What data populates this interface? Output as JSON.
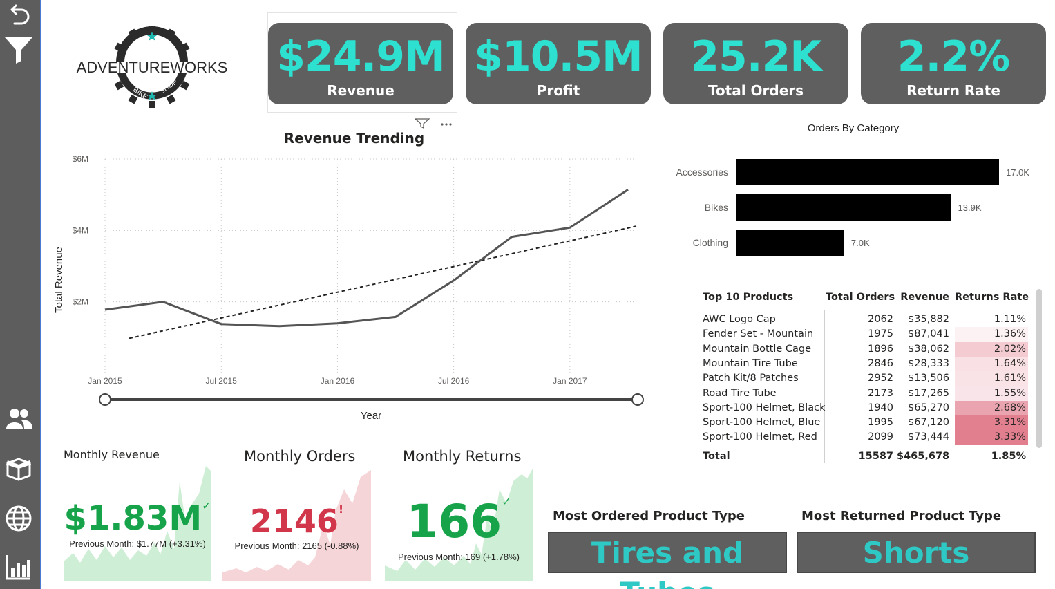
{
  "nav": {
    "items": [
      "back",
      "filter",
      "customers",
      "products",
      "map",
      "dashboard"
    ]
  },
  "logo": {
    "text": "ADVENTUREWORKS",
    "sub_left": "BIKE",
    "sub_right": "SHOP"
  },
  "kpis": [
    {
      "value": "$24.9M",
      "label": "Revenue"
    },
    {
      "value": "$10.5M",
      "label": "Profit"
    },
    {
      "value": "25.2K",
      "label": "Total Orders"
    },
    {
      "value": "2.2%",
      "label": "Return Rate"
    }
  ],
  "colors": {
    "accent": "#2ee0cf",
    "card_bg": "#5f5f5f",
    "nav_bg": "#5d5d5d",
    "green": "#16a34a",
    "red": "#d1364a"
  },
  "revenue_chart": {
    "title": "Revenue Trending",
    "x_axis_title": "Year",
    "y_axis_title": "Total Revenue"
  },
  "chart_data": [
    {
      "type": "line",
      "title": "Revenue Trending",
      "xlabel": "Year",
      "ylabel": "Total Revenue",
      "x_tick_labels": [
        "Jan 2015",
        "Jul 2015",
        "Jan 2016",
        "Jul 2016",
        "Jan 2017"
      ],
      "y_tick_labels": [
        "$2M",
        "$4M",
        "$6M"
      ],
      "ylim": [
        0,
        6000000
      ],
      "x": [
        "2015-01",
        "2015-04",
        "2015-07",
        "2015-10",
        "2016-01",
        "2016-04",
        "2016-07",
        "2016-10",
        "2017-01",
        "2017-04"
      ],
      "series": [
        {
          "values": [
            1780000,
            2000000,
            1380000,
            1320000,
            1400000,
            1580000,
            2600000,
            3820000,
            4080000,
            5140000
          ]
        }
      ],
      "trendline": {
        "start": 980000,
        "end": 4120000
      },
      "grid": true
    },
    {
      "type": "bar",
      "orientation": "horizontal",
      "title": "Orders By Category",
      "categories": [
        "Accessories",
        "Bikes",
        "Clothing"
      ],
      "values": [
        17000,
        13900,
        7000
      ],
      "value_labels": [
        "17.0K",
        "13.9K",
        "7.0K"
      ]
    }
  ],
  "table": {
    "headers": [
      "Top 10 Products",
      "Total Orders",
      "Revenue",
      "Returns Rate"
    ],
    "rows": [
      {
        "name": "AWC Logo Cap",
        "orders": "2062",
        "revenue": "$35,882",
        "rate": "1.11%",
        "heat": 0.0
      },
      {
        "name": "Fender Set - Mountain",
        "orders": "1975",
        "revenue": "$87,041",
        "rate": "1.36%",
        "heat": 0.11
      },
      {
        "name": "Mountain Bottle Cage",
        "orders": "1896",
        "revenue": "$38,062",
        "rate": "2.02%",
        "heat": 0.41
      },
      {
        "name": "Mountain Tire Tube",
        "orders": "2846",
        "revenue": "$28,333",
        "rate": "1.64%",
        "heat": 0.24
      },
      {
        "name": "Patch Kit/8 Patches",
        "orders": "2952",
        "revenue": "$13,506",
        "rate": "1.61%",
        "heat": 0.22
      },
      {
        "name": "Road Tire Tube",
        "orders": "2173",
        "revenue": "$17,265",
        "rate": "1.55%",
        "heat": 0.2
      },
      {
        "name": "Sport-100 Helmet, Black",
        "orders": "1940",
        "revenue": "$65,270",
        "rate": "2.68%",
        "heat": 0.71
      },
      {
        "name": "Sport-100 Helmet, Blue",
        "orders": "1995",
        "revenue": "$67,120",
        "rate": "3.31%",
        "heat": 0.99
      },
      {
        "name": "Sport-100 Helmet, Red",
        "orders": "2099",
        "revenue": "$73,444",
        "rate": "3.33%",
        "heat": 1.0
      }
    ],
    "total": {
      "name": "Total",
      "orders": "15587",
      "revenue": "$465,678",
      "rate": "1.85%"
    }
  },
  "monthly": {
    "revenue": {
      "title": "Monthly Revenue",
      "value": "$1.83M",
      "mark": "✓",
      "prev": "Previous Month: $1.77M (+3.31%)"
    },
    "orders": {
      "title": "Monthly Orders",
      "value": "2146",
      "mark": "!",
      "prev": "Previous Month: 2165 (-0.88%)"
    },
    "returns": {
      "title": "Monthly Returns",
      "value": "166",
      "mark": "✓",
      "prev": "Previous Month: 169 (+1.78%)"
    }
  },
  "most": {
    "ordered": {
      "title": "Most Ordered Product Type",
      "value": "Tires and Tubes"
    },
    "returned": {
      "title": "Most Returned Product Type",
      "value": "Shorts"
    }
  }
}
